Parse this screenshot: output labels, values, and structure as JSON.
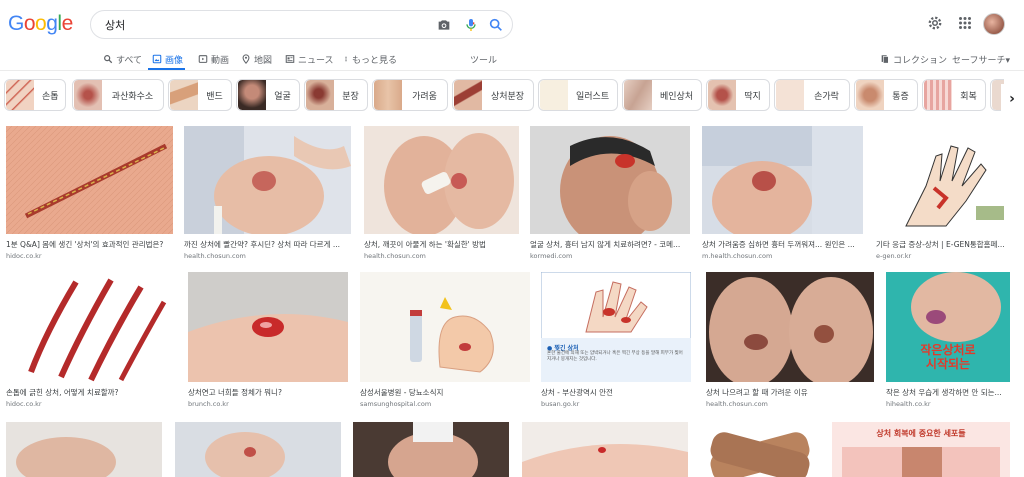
{
  "search": {
    "query": "상처"
  },
  "tabs": [
    {
      "label": "すべて",
      "icon": "search-icon"
    },
    {
      "label": "画像",
      "icon": "image-icon",
      "active": true
    },
    {
      "label": "動画",
      "icon": "video-icon"
    },
    {
      "label": "地図",
      "icon": "map-pin-icon"
    },
    {
      "label": "ニュース",
      "icon": "news-icon"
    },
    {
      "label": "もっと見る",
      "icon": "more-vert-icon"
    },
    {
      "label": "ツール"
    }
  ],
  "right_tools": {
    "collections": "コレクション",
    "safesearch": "セーフサーチ▾"
  },
  "chips": [
    {
      "label": "손톱",
      "color": "#c9503f"
    },
    {
      "label": "과산화수소",
      "color": "#b5524a"
    },
    {
      "label": "밴드",
      "color": "#d8a07a"
    },
    {
      "label": "얼굴",
      "color": "#c48a78"
    },
    {
      "label": "분장",
      "color": "#8a3a32"
    },
    {
      "label": "가려움",
      "color": "#d9a98a"
    },
    {
      "label": "상처분장",
      "color": "#9c3f35"
    },
    {
      "label": "일러스트",
      "color": "#e8d7b8"
    },
    {
      "label": "베인상처",
      "color": "#c7a393"
    },
    {
      "label": "딱지",
      "color": "#b4524a"
    },
    {
      "label": "손가락",
      "color": "#e6c1b0"
    },
    {
      "label": "통증",
      "color": "#c98a6e"
    },
    {
      "label": "회복",
      "color": "#e7a5a0"
    }
  ],
  "results": [
    {
      "caption": "1분 Q&A] 몸에 생긴 '상처'의 효과적인 관리법은?",
      "source": "hidoc.co.kr"
    },
    {
      "caption": "까진 상처에 빨간약? 후시딘? 상처 따라 다르게 ...",
      "source": "health.chosun.com"
    },
    {
      "caption": "상처, 깨끗이 아물게 하는 '확실한' 방법",
      "source": "health.chosun.com"
    },
    {
      "caption": "얼굴 상처, 흉터 남지 않게 치료하려면? - 코메...",
      "source": "kormedi.com"
    },
    {
      "caption": "상처 가려움증 심하면 흉터 두꺼워져... 원인은 ...",
      "source": "m.health.chosun.com"
    },
    {
      "caption": "기타 응급 증상-상처 | E-GEN통합홈페...",
      "source": "e-gen.or.kr"
    },
    {
      "caption": "손톱에 긁힌 상처, 어떻게 치료할까?",
      "source": "hidoc.co.kr"
    },
    {
      "caption": "상처연고 너희들 정체가 뭐니?",
      "source": "brunch.co.kr"
    },
    {
      "caption": "삼성서울병원 - 당뇨소식지",
      "source": "samsunghospital.com"
    },
    {
      "caption": "상처 - 부산광역시 안전",
      "source": "busan.go.kr"
    },
    {
      "caption": "상처 나으려고 할 때 가려운 이유",
      "source": "health.chosun.com"
    },
    {
      "caption": "작은 상처 우습게 생각하면 안 되는...",
      "source": "hihealth.co.kr"
    }
  ],
  "image_text": {
    "busan_label": "● 찢긴 상처",
    "busan_body": "혼한 물건에 의해 또는 압박되거나 혹은 찍긴 부상 등을 말해 피부가 찢어지거나 뭉개지는 것입니다.",
    "hihealth_title1": "작은상처로",
    "hihealth_title2": "시작되는",
    "row3_banner": "상처 회복에 중요한 세포들"
  }
}
